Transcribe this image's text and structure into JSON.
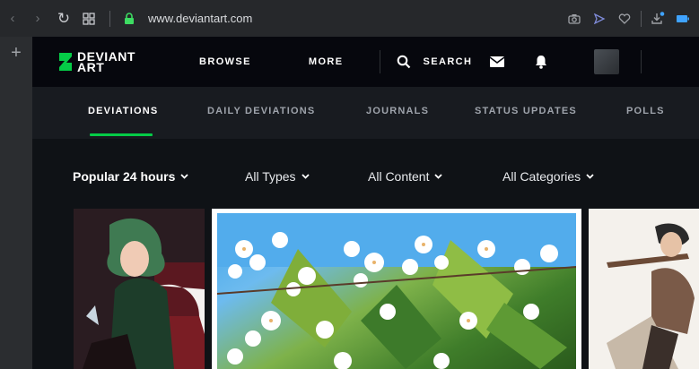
{
  "browser": {
    "url": "www.deviantart.com"
  },
  "header": {
    "logo_line1": "DEVIANT",
    "logo_line2": "ART",
    "browse": "BROWSE",
    "more": "MORE",
    "search": "SEARCH"
  },
  "tabs": [
    {
      "label": "DEVIATIONS",
      "active": true
    },
    {
      "label": "DAILY DEVIATIONS",
      "active": false
    },
    {
      "label": "JOURNALS",
      "active": false
    },
    {
      "label": "STATUS UPDATES",
      "active": false
    },
    {
      "label": "POLLS",
      "active": false
    }
  ],
  "filters": {
    "sort": "Popular 24 hours",
    "types": "All Types",
    "content": "All Content",
    "categories": "All Categories"
  },
  "colors": {
    "accent": "#05cc47",
    "header_bg": "#06070d",
    "tabs_bg": "#181b20"
  }
}
